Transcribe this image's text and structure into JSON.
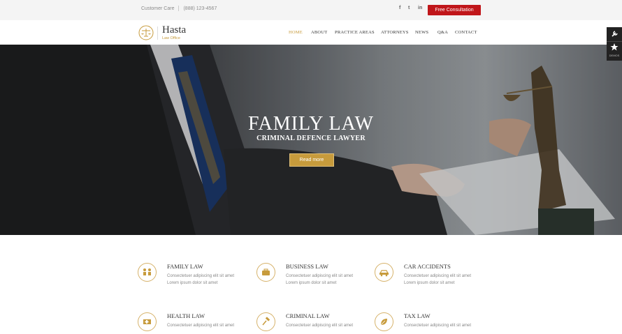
{
  "topbar": {
    "customer_care": "Customer Care",
    "phone": "(888) 123-4567",
    "social": [
      {
        "icon": "facebook-icon",
        "glyph": "f"
      },
      {
        "icon": "twitter-icon",
        "glyph": "t"
      },
      {
        "icon": "linkedin-icon",
        "glyph": "in"
      }
    ],
    "consult_button": "Free Consultation"
  },
  "brand": {
    "name": "Hasta",
    "tagline": "Law Office",
    "accent": "#c79b3c",
    "red": "#c0161a"
  },
  "nav": [
    "HOME",
    "ABOUT",
    "PRACTICE AREAS",
    "ATTORNEYS",
    "NEWS",
    "Q&A",
    "CONTACT"
  ],
  "side_tools": {
    "tool1_icon": "wrench-icon",
    "tool2_icon": "star-icon",
    "tool2_label": "DEMOS"
  },
  "hero": {
    "title": "FAMILY LAW",
    "subtitle": "CRIMINAL DEFENCE LAWYER",
    "button": "Read more"
  },
  "services": [
    {
      "title": "FAMILY LAW",
      "line1": "Consectetuer adipiscing elit sit amet",
      "line2": "Lorem ipsum dolor sit amet",
      "icon": "family-icon"
    },
    {
      "title": "BUSINESS LAW",
      "line1": "Consectetuer adipiscing elit sit amet",
      "line2": "Lorem ipsum dolor sit amet",
      "icon": "briefcase-icon"
    },
    {
      "title": "CAR ACCIDENTS",
      "line1": "Consectetuer adipiscing elit sit amet",
      "line2": "Lorem ipsum dolor sit amet",
      "icon": "car-icon"
    },
    {
      "title": "HEALTH LAW",
      "line1": "Consectetuer adipiscing elit sit amet",
      "line2": "",
      "icon": "ambulance-icon"
    },
    {
      "title": "CRIMINAL LAW",
      "line1": "Consectetuer adipiscing elit sit amet",
      "line2": "",
      "icon": "gavel-icon"
    },
    {
      "title": "TAX LAW",
      "line1": "Consectetuer adipiscing elit sit amet",
      "line2": "",
      "icon": "leaf-icon"
    }
  ]
}
